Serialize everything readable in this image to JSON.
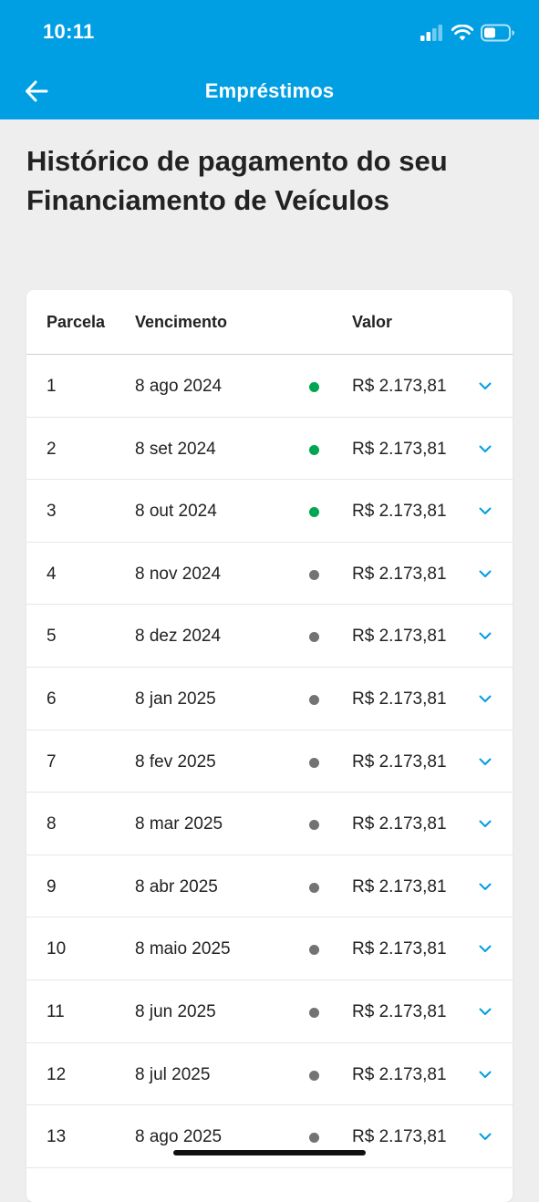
{
  "status_bar": {
    "time": "10:11"
  },
  "header": {
    "title": "Empréstimos"
  },
  "page": {
    "title": "Histórico de pagamento do seu Financiamento de Veículos"
  },
  "table": {
    "headers": {
      "installment": "Parcela",
      "due_date": "Vencimento",
      "amount": "Valor"
    },
    "rows": [
      {
        "installment": "1",
        "due_date": "8 ago 2024",
        "status": "paid",
        "amount": "R$ 2.173,81"
      },
      {
        "installment": "2",
        "due_date": "8 set 2024",
        "status": "paid",
        "amount": "R$ 2.173,81"
      },
      {
        "installment": "3",
        "due_date": "8 out 2024",
        "status": "paid",
        "amount": "R$ 2.173,81"
      },
      {
        "installment": "4",
        "due_date": "8 nov 2024",
        "status": "pending",
        "amount": "R$ 2.173,81"
      },
      {
        "installment": "5",
        "due_date": "8 dez 2024",
        "status": "pending",
        "amount": "R$ 2.173,81"
      },
      {
        "installment": "6",
        "due_date": "8 jan 2025",
        "status": "pending",
        "amount": "R$ 2.173,81"
      },
      {
        "installment": "7",
        "due_date": "8 fev 2025",
        "status": "pending",
        "amount": "R$ 2.173,81"
      },
      {
        "installment": "8",
        "due_date": "8 mar 2025",
        "status": "pending",
        "amount": "R$ 2.173,81"
      },
      {
        "installment": "9",
        "due_date": "8 abr 2025",
        "status": "pending",
        "amount": "R$ 2.173,81"
      },
      {
        "installment": "10",
        "due_date": "8 maio 2025",
        "status": "pending",
        "amount": "R$ 2.173,81"
      },
      {
        "installment": "11",
        "due_date": "8 jun 2025",
        "status": "pending",
        "amount": "R$ 2.173,81"
      },
      {
        "installment": "12",
        "due_date": "8 jul 2025",
        "status": "pending",
        "amount": "R$ 2.173,81"
      },
      {
        "installment": "13",
        "due_date": "8 ago 2025",
        "status": "pending",
        "amount": "R$ 2.173,81"
      }
    ]
  },
  "colors": {
    "brand": "#009ee3",
    "status_paid": "#00a650",
    "status_pending": "#737373",
    "chevron": "#009ee3"
  },
  "icons": {
    "back": "arrow-left-icon",
    "expand": "chevron-down-icon",
    "signal": "cellular-signal-icon",
    "wifi": "wifi-icon",
    "battery": "battery-icon"
  }
}
